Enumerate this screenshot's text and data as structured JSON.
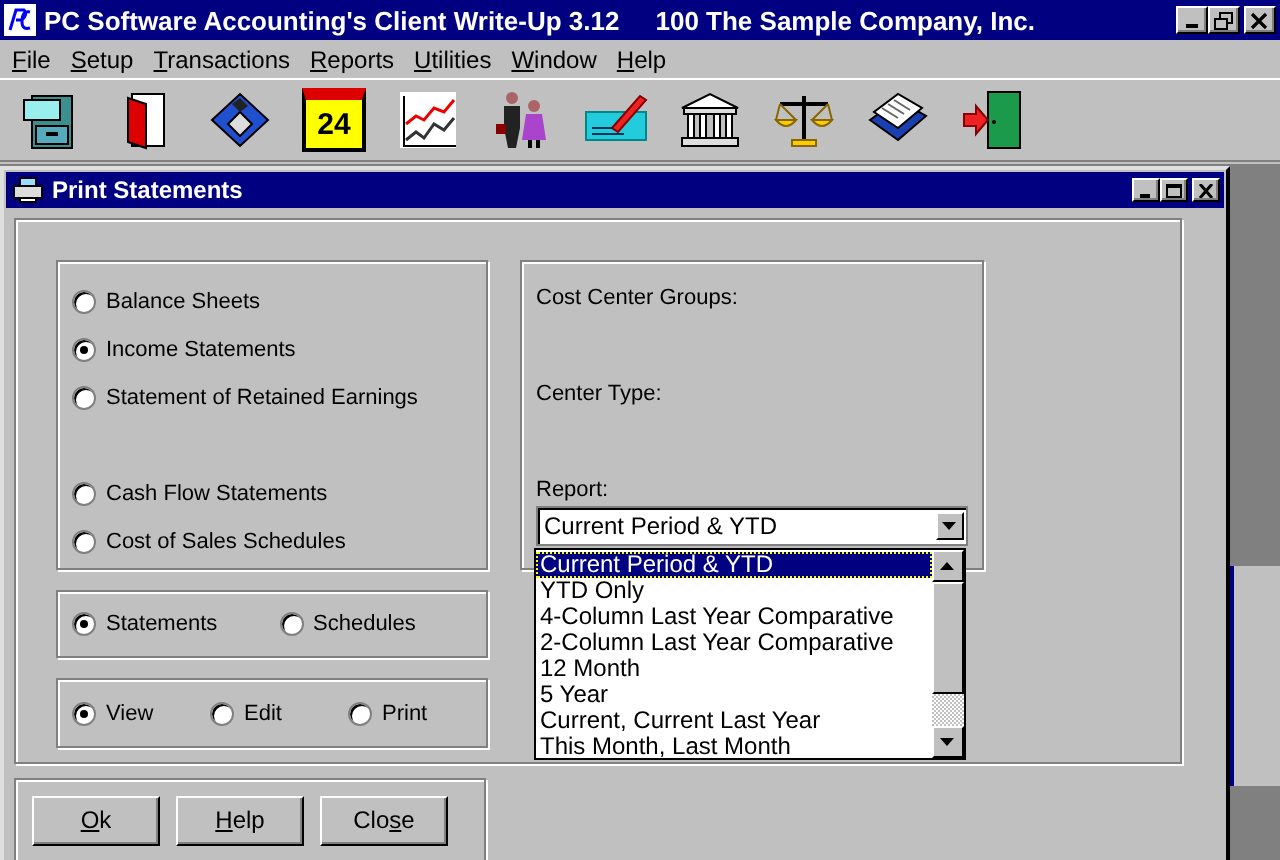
{
  "app": {
    "title": "PC Software Accounting's Client Write-Up 3.12     100 The Sample Company, Inc."
  },
  "menu": [
    {
      "label": "File"
    },
    {
      "label": "Setup"
    },
    {
      "label": "Transactions"
    },
    {
      "label": "Reports"
    },
    {
      "label": "Utilities"
    },
    {
      "label": "Window"
    },
    {
      "label": "Help"
    }
  ],
  "toolbar": [
    {
      "kind": "cabinet"
    },
    {
      "kind": "door"
    },
    {
      "kind": "floppy"
    },
    {
      "kind": "calendar",
      "text": "24"
    },
    {
      "kind": "chart"
    },
    {
      "kind": "people"
    },
    {
      "kind": "cheque"
    },
    {
      "kind": "bank"
    },
    {
      "kind": "scales"
    },
    {
      "kind": "book"
    },
    {
      "kind": "exit"
    }
  ],
  "dialog": {
    "title": "Print Statements",
    "statement_types": [
      [
        {
          "label": "Balance Sheets",
          "selected": false
        },
        {
          "label": "Income Statements",
          "selected": true
        },
        {
          "label": "Statement of Retained Earnings",
          "selected": false
        }
      ],
      [
        {
          "label": "Cash Flow Statements",
          "selected": false
        },
        {
          "label": "Cost of Sales Schedules",
          "selected": false
        }
      ]
    ],
    "output": [
      {
        "label": "Statements",
        "selected": true
      },
      {
        "label": "Schedules",
        "selected": false
      }
    ],
    "mode": [
      {
        "label": "View",
        "selected": true
      },
      {
        "label": "Edit",
        "selected": false
      },
      {
        "label": "Print",
        "selected": false
      }
    ],
    "labels": [
      "Cost Center Groups:",
      "Center Type:",
      "Report:"
    ],
    "report": {
      "value": "Current Period & YTD",
      "options": [
        {
          "label": "Current Period & YTD",
          "selected": true
        },
        {
          "label": "YTD Only",
          "selected": false
        },
        {
          "label": "4-Column Last Year Comparative",
          "selected": false
        },
        {
          "label": "2-Column Last Year Comparative",
          "selected": false
        },
        {
          "label": "12 Month",
          "selected": false
        },
        {
          "label": "5 Year",
          "selected": false
        },
        {
          "label": "Current, Current Last Year",
          "selected": false
        },
        {
          "label": "This Month, Last Month",
          "selected": false
        }
      ]
    },
    "buttons": [
      {
        "accel": "O",
        "rest": "k"
      },
      {
        "accel": "H",
        "rest": "elp"
      },
      {
        "start": "Clo",
        "accel": "s",
        "rest": "e"
      }
    ]
  }
}
